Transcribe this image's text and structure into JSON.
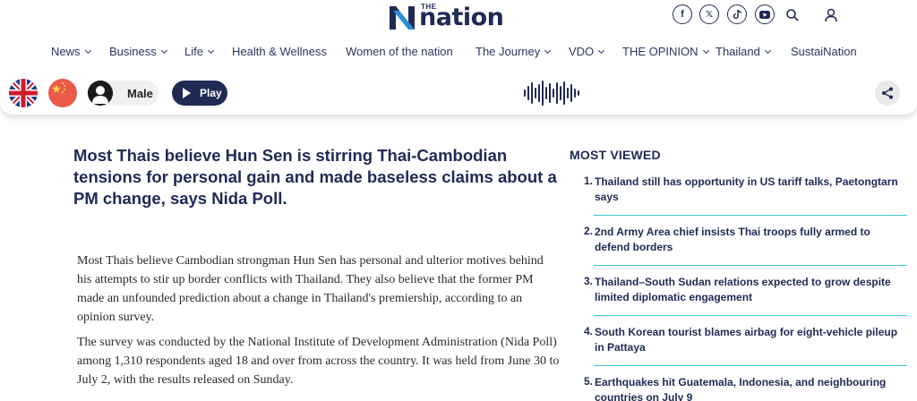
{
  "brand": {
    "the": "THE",
    "name": "nation"
  },
  "header_icons": [
    "facebook-icon",
    "x-icon",
    "tiktok-icon",
    "youtube-icon",
    "search-icon",
    "user-icon"
  ],
  "social_glyphs": {
    "facebook": "f",
    "x": "𝕏"
  },
  "nav": [
    {
      "label": "News",
      "dropdown": true
    },
    {
      "label": "Business",
      "dropdown": true
    },
    {
      "label": "Life",
      "dropdown": true
    },
    {
      "label": "Health & Wellness",
      "dropdown": false
    },
    {
      "label": "Women of the nation",
      "dropdown": false
    },
    {
      "label": "The Journey",
      "dropdown": true
    },
    {
      "label": "VDO",
      "dropdown": true
    },
    {
      "label": "THE OPINION",
      "dropdown": true
    },
    {
      "label": "Thailand",
      "dropdown": true
    },
    {
      "label": "SustaiNation",
      "dropdown": false
    }
  ],
  "toolbar": {
    "voice_label": "Male",
    "play_label": "Play",
    "languages": [
      "uk-flag",
      "china-flag"
    ]
  },
  "article": {
    "headline": "Most Thais believe Hun Sen is stirring Thai-Cambodian tensions for personal gain and made baseless claims about a PM change, says Nida Poll.",
    "paragraphs": [
      "Most Thais believe Cambodian strongman Hun Sen has personal and ulterior motives behind his attempts to stir up border conflicts with Thailand. They also believe that the former PM made an unfounded prediction about a change in Thailand's premiership, according to an opinion survey.",
      "The survey was conducted by the National Institute of Development Administration (Nida Poll) among 1,310 respondents aged 18 and over from across the country. It was held from June 30 to July 2, with the results released on Sunday."
    ]
  },
  "most_viewed": {
    "title": "MOST VIEWED",
    "items": [
      {
        "num": "1.",
        "text": "Thailand still has opportunity in US tariff talks, Paetongtarn says"
      },
      {
        "num": "2.",
        "text": "2nd Army Area chief insists Thai troops fully armed to defend borders"
      },
      {
        "num": "3.",
        "text": "Thailand–South Sudan relations expected to grow despite limited diplomatic engagement"
      },
      {
        "num": "4.",
        "text": "South Korean tourist blames airbag for eight-vehicle pileup in Pattaya"
      },
      {
        "num": "5.",
        "text": "Earthquakes hit Guatemala, Indonesia, and neighbouring countries on July 9"
      }
    ]
  },
  "colors": {
    "navy": "#1f2a55",
    "accent_rule": "#3ec7d6",
    "logo_blue": "#2a8fd6"
  }
}
